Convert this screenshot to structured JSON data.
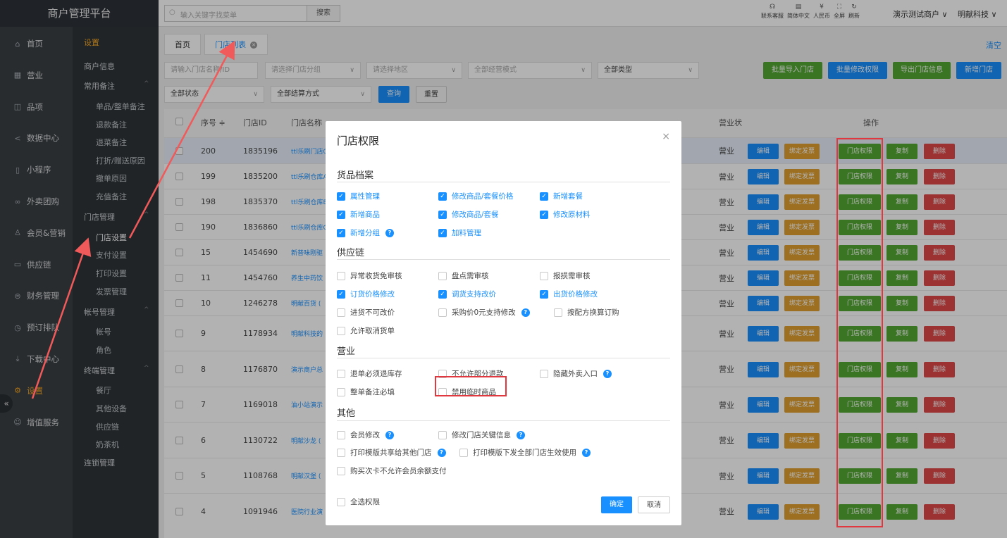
{
  "brand": "商户管理平台",
  "search": {
    "placeholder": "输入关键字找菜单",
    "button": "搜索"
  },
  "top_icons": [
    {
      "icon": "headset-icon",
      "glyph": "☊",
      "label": "联系客服"
    },
    {
      "icon": "document-icon",
      "glyph": "▤",
      "label": "简体中文"
    },
    {
      "icon": "currency-icon",
      "glyph": "¥",
      "label": "人民币"
    },
    {
      "icon": "fullscreen-icon",
      "glyph": "⛶",
      "label": "全屏"
    },
    {
      "icon": "refresh-icon",
      "glyph": "↻",
      "label": "刷新"
    }
  ],
  "top_user": {
    "merchant": "演示测试商户 ∨",
    "company": "明献科技 ∨"
  },
  "left_nav": [
    {
      "label": "首页",
      "icon": "home-icon",
      "glyph": "⌂"
    },
    {
      "label": "营业",
      "icon": "calendar-icon",
      "glyph": "▦"
    },
    {
      "label": "品项",
      "icon": "bag-icon",
      "glyph": "◫"
    },
    {
      "label": "数据中心",
      "icon": "share-icon",
      "glyph": "<"
    },
    {
      "label": "小程序",
      "icon": "phone-icon",
      "glyph": "▯"
    },
    {
      "label": "外卖团购",
      "icon": "group-icon",
      "glyph": "∞"
    },
    {
      "label": "会员&营销",
      "icon": "user-icon",
      "glyph": "♙"
    },
    {
      "label": "供应链",
      "icon": "truck-icon",
      "glyph": "▭"
    },
    {
      "label": "财务管理",
      "icon": "coins-icon",
      "glyph": "⊜"
    },
    {
      "label": "预订排队",
      "icon": "clock-icon",
      "glyph": "◷"
    },
    {
      "label": "下载中心",
      "icon": "download-icon",
      "glyph": "⤓"
    },
    {
      "label": "设置",
      "icon": "gear-icon",
      "glyph": "⚙"
    },
    {
      "label": "增值服务",
      "icon": "service-icon",
      "glyph": "☺"
    }
  ],
  "sub_nav": {
    "title": "设置",
    "items": [
      {
        "label": "商户信息",
        "type": "sec"
      },
      {
        "label": "常用备注",
        "type": "sec",
        "caret": "^"
      },
      {
        "label": "单品/整单备注",
        "type": "sub"
      },
      {
        "label": "退款备注",
        "type": "sub"
      },
      {
        "label": "退菜备注",
        "type": "sub"
      },
      {
        "label": "打折/赠送原因",
        "type": "sub"
      },
      {
        "label": "撤单原因",
        "type": "sub"
      },
      {
        "label": "充值备注",
        "type": "sub"
      },
      {
        "label": "门店管理",
        "type": "sec",
        "caret": "^"
      },
      {
        "label": "门店设置",
        "type": "sub"
      },
      {
        "label": "支付设置",
        "type": "sub"
      },
      {
        "label": "打印设置",
        "type": "sub"
      },
      {
        "label": "发票管理",
        "type": "sub"
      },
      {
        "label": "帐号管理",
        "type": "sec",
        "caret": "^"
      },
      {
        "label": "帐号",
        "type": "sub"
      },
      {
        "label": "角色",
        "type": "sub"
      },
      {
        "label": "终端管理",
        "type": "sec",
        "caret": "^"
      },
      {
        "label": "餐厅",
        "type": "sub"
      },
      {
        "label": "其他设备",
        "type": "sub"
      },
      {
        "label": "供应链",
        "type": "sub"
      },
      {
        "label": "奶茶机",
        "type": "sub"
      },
      {
        "label": "连锁管理",
        "type": "sec"
      }
    ]
  },
  "tabs": [
    {
      "label": "首页"
    },
    {
      "label": "门店列表"
    }
  ],
  "clear_label": "清空",
  "filters": {
    "store_input": "请输入门店名称/ID",
    "group": "请选择门店分组",
    "region": "请选择地区",
    "mode": "全部经营模式",
    "type": "全部类型",
    "status": "全部状态",
    "settlement": "全部结算方式",
    "query": "查询",
    "reset": "重置"
  },
  "actions_top": [
    "批量导入门店",
    "批量修改权限",
    "导出门店信息",
    "新增门店"
  ],
  "table": {
    "headers": [
      "序号 ≑",
      "门店ID",
      "门店名称",
      "营业状",
      "操作"
    ],
    "rows": [
      {
        "no": "200",
        "id": "1835196",
        "name": "ttl乐刷门店0",
        "status": "营业"
      },
      {
        "no": "199",
        "id": "1835200",
        "name": "ttl乐刷仓库A",
        "status": "营业"
      },
      {
        "no": "198",
        "id": "1835370",
        "name": "ttl乐刷仓库B",
        "status": "营业"
      },
      {
        "no": "190",
        "id": "1836860",
        "name": "ttl乐刷仓库C",
        "status": "营业"
      },
      {
        "no": "15",
        "id": "1454690",
        "name": "新普味刚驱",
        "status": "营业"
      },
      {
        "no": "11",
        "id": "1454760",
        "name": "养生中药饮",
        "status": "营业"
      },
      {
        "no": "10",
        "id": "1246278",
        "name": "明献百货 (",
        "status": "营业"
      },
      {
        "no": "9",
        "id": "1178934",
        "name": "明献科技的",
        "status": "营业"
      },
      {
        "no": "8",
        "id": "1176870",
        "name": "演示商户总",
        "status": "营业"
      },
      {
        "no": "7",
        "id": "1169018",
        "name": "油小站演示",
        "status": "营业"
      },
      {
        "no": "6",
        "id": "1130722",
        "name": "明献沙龙 (",
        "status": "营业"
      },
      {
        "no": "5",
        "id": "1108768",
        "name": "明献汉堡 (",
        "status": "营业"
      },
      {
        "no": "4",
        "id": "1091946",
        "name": "医院行业演",
        "status": "营业"
      }
    ],
    "row_actions": [
      "编辑",
      "绑定发票",
      "门店权限",
      "复制",
      "删除"
    ]
  },
  "modal": {
    "title": "门店权限",
    "close": "×",
    "groups": [
      {
        "title": "货品档案",
        "items": [
          {
            "label": "属性管理",
            "checked": true
          },
          {
            "label": "修改商品/套餐价格",
            "checked": true
          },
          {
            "label": "新增套餐",
            "checked": true
          },
          {
            "label": "新增商品",
            "checked": true
          },
          {
            "label": "修改商品/套餐",
            "checked": true
          },
          {
            "label": "修改原材料",
            "checked": true
          },
          {
            "label": "新增分组",
            "checked": true,
            "help": true
          },
          {
            "label": "加料管理",
            "checked": true
          }
        ]
      },
      {
        "title": "供应链",
        "items": [
          {
            "label": "异常收货免审核",
            "checked": false
          },
          {
            "label": "盘点需审核",
            "checked": false
          },
          {
            "label": "报损需审核",
            "checked": false
          },
          {
            "label": "订货价格修改",
            "checked": true
          },
          {
            "label": "调货支持改价",
            "checked": true
          },
          {
            "label": "出货价格修改",
            "checked": true
          },
          {
            "label": "进货不可改价",
            "checked": false
          },
          {
            "label": "采购价0元支持修改",
            "checked": false,
            "help": true
          },
          {
            "label": "按配方换算订购",
            "checked": false
          },
          {
            "label": "允许取消货单",
            "checked": false
          }
        ]
      },
      {
        "title": "营业",
        "items": [
          {
            "label": "退单必须退库存",
            "checked": false
          },
          {
            "label": "不允许部分退款",
            "checked": false
          },
          {
            "label": "隐藏外卖入口",
            "checked": false,
            "help": true
          },
          {
            "label": "整单备注必填",
            "checked": false
          },
          {
            "label": "禁用临时商品",
            "checked": false
          }
        ]
      },
      {
        "title": "其他",
        "items": [
          {
            "label": "会员修改",
            "checked": false,
            "help": true
          },
          {
            "label": "修改门店关键信息",
            "checked": false,
            "help": true
          },
          {
            "label": "打印模版共享给其他门店",
            "checked": false,
            "help": true
          },
          {
            "label": "打印模版下发全部门店生效使用",
            "checked": false,
            "help": true
          },
          {
            "label": "购买次卡不允许会员余额支付",
            "checked": false
          }
        ]
      }
    ],
    "select_all": "全选权限",
    "ok": "确定",
    "cancel": "取消"
  },
  "colors": {
    "primary": "#1890ff",
    "green": "#52a832",
    "orange": "#e0a030",
    "red": "#e04848",
    "annotation": "#e0383e",
    "sidebar": "#3a3f44"
  }
}
